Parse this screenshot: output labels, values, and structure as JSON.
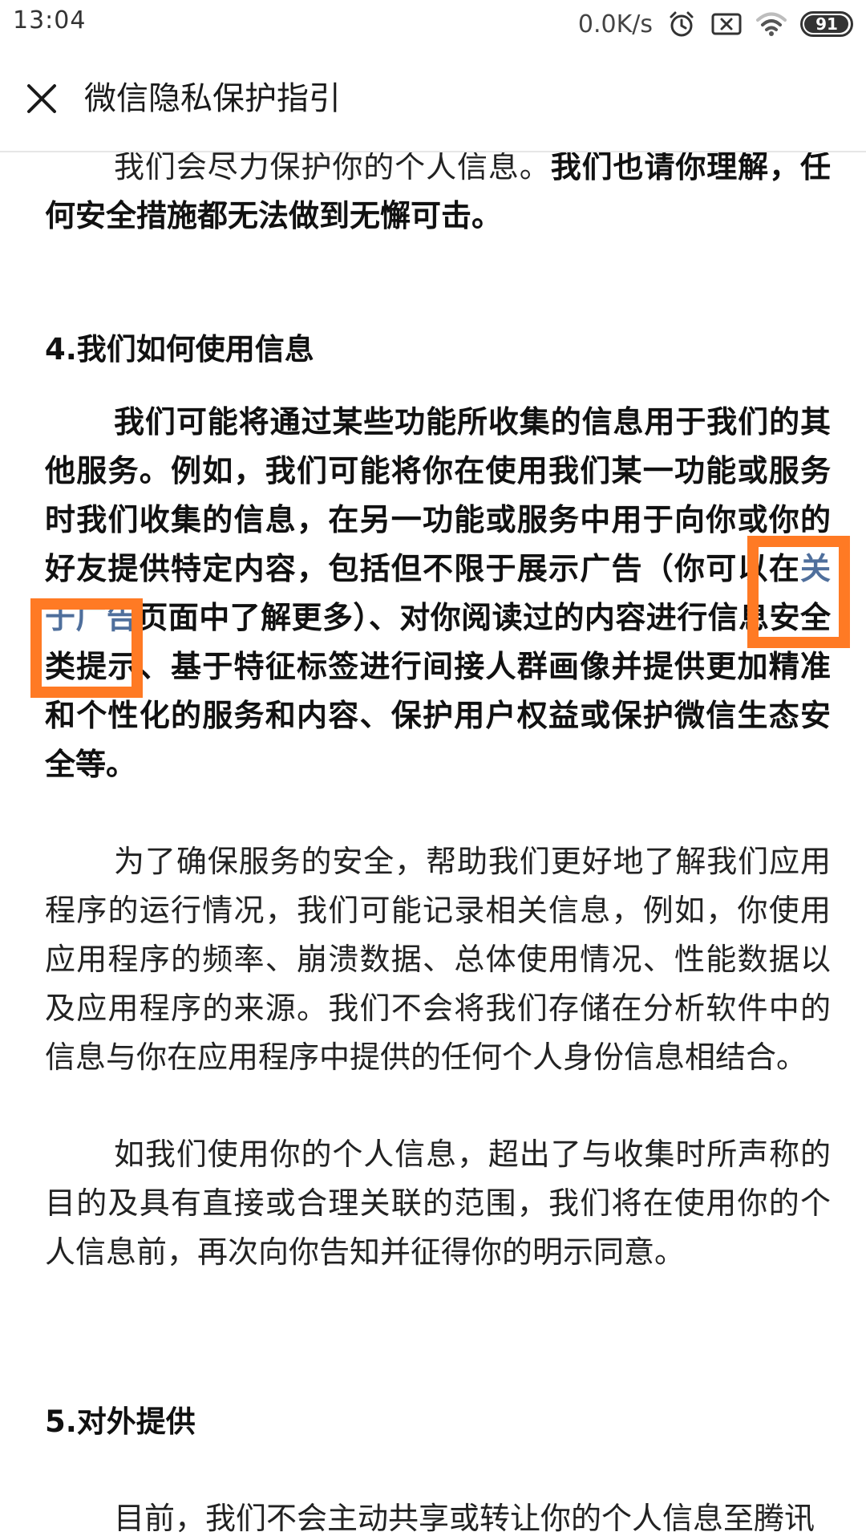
{
  "status_bar": {
    "time": "13:04",
    "net_speed": "0.0K/s",
    "battery": "91",
    "icons": [
      "alarm-clock-icon",
      "notification-x-icon",
      "wifi-icon",
      "battery-icon"
    ]
  },
  "header": {
    "title": "微信隐私保护指引",
    "close_icon": "close-icon"
  },
  "article": {
    "p1_normal": "我们会尽力保护你的个人信息。",
    "p1_bold": "我们也请你理解，任何安全措施都无法做到无懈可击。",
    "h4": "4.我们如何使用信息",
    "p2_before_link": "我们可能将通过某些功能所收集的信息用于我们的其他服务。例如，我们可能将你在使用我们某一功能或服务时我们收集的信息，在另一功能或服务中用于向你或你的好友提供特定内容，包括但不限于展示广告（你可以在",
    "p2_link": "关于广告",
    "p2_after_link": "页面中了解更多）、对你阅读过的内容进行信息安全类提示、基于特征标签进行间接人群画像并提供更加精准和个性化的服务和内容、保护用户权益或保护微信生态安全等。",
    "p3": "为了确保服务的安全，帮助我们更好地了解我们应用程序的运行情况，我们可能记录相关信息，例如，你使用应用程序的频率、崩溃数据、总体使用情况、性能数据以及应用程序的来源。我们不会将我们存储在分析软件中的信息与你在应用程序中提供的任何个人身份信息相结合。",
    "p4": "如我们使用你的个人信息，超出了与收集时所声称的目的及具有直接或合理关联的范围，我们将在使用你的个人信息前，再次向你告知并征得你的明示同意。",
    "h5": "5.对外提供",
    "p5": "目前，我们不会主动共享或转让你的个人信息至腾讯"
  },
  "highlight_color": "#ff7a24",
  "link_color": "#4f6f9c"
}
